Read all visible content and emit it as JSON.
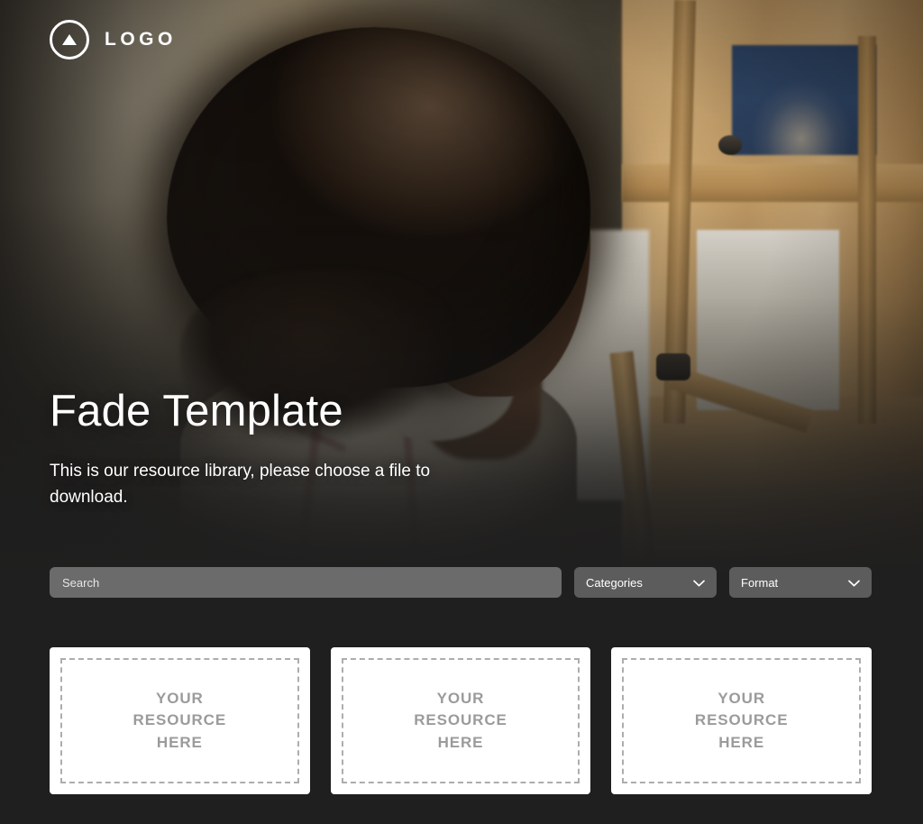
{
  "brand": {
    "logo_text": "LOGO",
    "logo_icon": "triangle-in-circle-icon"
  },
  "hero": {
    "title": "Fade Template",
    "subtitle": "This is our resource library, please choose a file to download.",
    "image_description": "Woman with curly hair painting at a wooden easel in a warm-lit studio"
  },
  "filters": {
    "search": {
      "placeholder": "Search",
      "value": ""
    },
    "categories": {
      "label": "Categories",
      "icon": "chevron-down-icon"
    },
    "format": {
      "label": "Format",
      "icon": "chevron-down-icon"
    }
  },
  "cards": [
    {
      "text": "YOUR\nRESOURCE\nHERE"
    },
    {
      "text": "YOUR\nRESOURCE\nHERE"
    },
    {
      "text": "YOUR\nRESOURCE\nHERE"
    }
  ],
  "colors": {
    "page_background": "#1f1f1f",
    "search_field": "#6b6b6b",
    "dropdown": "#5c5c5c",
    "card_background": "#ffffff",
    "card_text": "#9b9b9b",
    "card_dash_border": "#adadad",
    "text_on_hero": "#ffffff"
  }
}
